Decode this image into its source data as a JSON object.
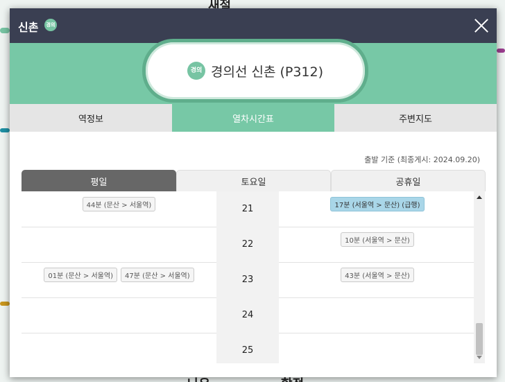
{
  "header": {
    "title": "신촌",
    "badge": "경의"
  },
  "station": {
    "badge": "경의",
    "name": "경의선 신촌 (P312)"
  },
  "tabs": [
    {
      "label": "역정보"
    },
    {
      "label": "열차시간표"
    },
    {
      "label": "주변지도"
    }
  ],
  "stamp": "출발 기준 (최종게시: 2024.09.20)",
  "day_tabs": [
    {
      "label": "평일"
    },
    {
      "label": "토요일"
    },
    {
      "label": "공휴일"
    }
  ],
  "rows": [
    {
      "hour": "21",
      "weekday": [
        "44분 (문산 > 서울역)"
      ],
      "holiday": [
        "17분 (서울역 > 문산) (급행)"
      ]
    },
    {
      "hour": "22",
      "weekday": [],
      "holiday": [
        "10분 (서울역 > 문산)"
      ]
    },
    {
      "hour": "23",
      "weekday": [
        "01분 (문산 > 서울역)",
        "47분 (문산 > 서울역)"
      ],
      "holiday": [
        "43분 (서울역 > 문산)"
      ]
    },
    {
      "hour": "24",
      "weekday": [],
      "holiday": []
    },
    {
      "hour": "25",
      "weekday": [],
      "holiday": []
    }
  ],
  "colors": {
    "header": "#3a3f52",
    "accent": "#77c8a6",
    "express": "#a9d6e8"
  }
}
